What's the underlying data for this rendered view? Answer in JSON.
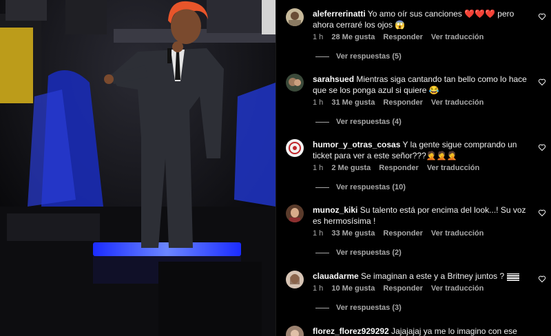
{
  "comments": [
    {
      "username": "aleferrerinatti",
      "text": "Yo amo oír sus canciones ❤️❤️❤️ pero ahora cerraré los ojos 😱",
      "time": "1 h",
      "likes": "28 Me gusta",
      "reply": "Responder",
      "translate": "Ver traducción",
      "replies": "Ver respuestas (5)"
    },
    {
      "username": "sarahsued",
      "text": "Mientras siga cantando tan bello como lo hace que se los ponga azul si quiere 😂",
      "time": "1 h",
      "likes": "31 Me gusta",
      "reply": "Responder",
      "translate": "Ver traducción",
      "replies": "Ver respuestas (4)"
    },
    {
      "username": "humor_y_otras_cosas",
      "text": "Y la gente sigue comprando un ticket para ver a este señor???🤦🤦🤦",
      "time": "1 h",
      "likes": "2 Me gusta",
      "reply": "Responder",
      "translate": "Ver traducción",
      "replies": "Ver respuestas (10)"
    },
    {
      "username": "munoz_kiki",
      "text": "Su talento está por encima del look...! Su voz es hermosísima !",
      "time": "1 h",
      "likes": "33 Me gusta",
      "reply": "Responder",
      "translate": "Ver traducción",
      "replies": "Ver respuestas (2)"
    },
    {
      "username": "clauadarme",
      "text": "Se imaginan a este y a Britney juntos ?",
      "time": "1 h",
      "likes": "10 Me gusta",
      "reply": "Responder",
      "translate": "Ver traducción",
      "replies": "Ver respuestas (3)"
    },
    {
      "username": "florez_florez929292",
      "text": "Jajajajaj ya me lo imagino con ese",
      "time": "",
      "likes": "",
      "reply": "",
      "translate": "",
      "replies": ""
    }
  ],
  "colors": {
    "background": "#000000",
    "text": "#f5f5f5",
    "muted": "#a8a8a8",
    "hair": "#e8552a",
    "stage_led": "#3d5cff"
  },
  "icons": {
    "like": "heart-outline-icon"
  }
}
